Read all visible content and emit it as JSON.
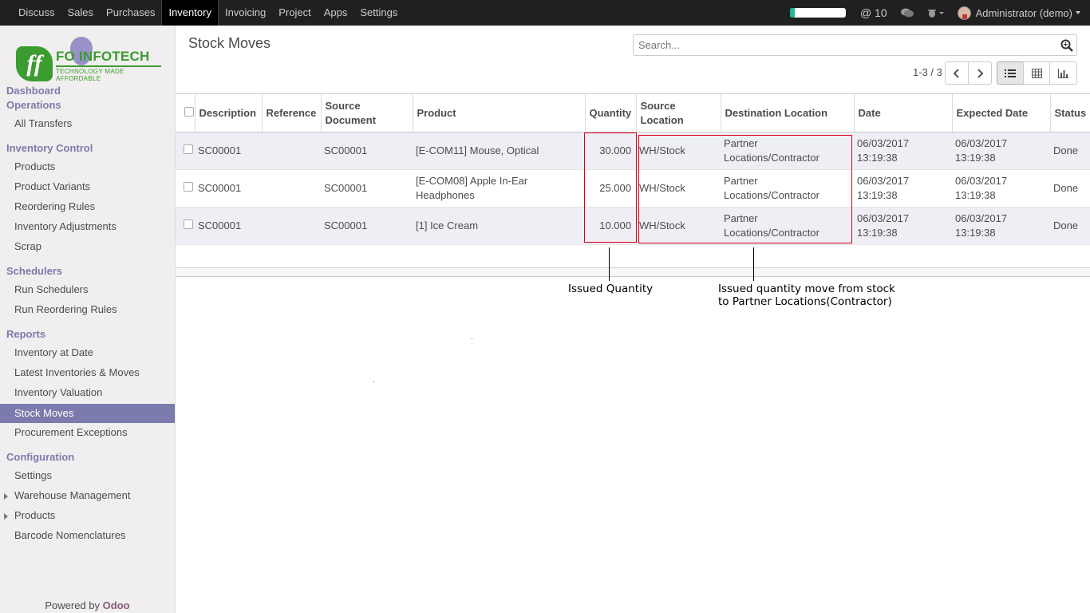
{
  "topbar": {
    "menu": [
      "Discuss",
      "Sales",
      "Purchases",
      "Inventory",
      "Invoicing",
      "Project",
      "Apps",
      "Settings"
    ],
    "active_menu": "Inventory",
    "progress_fraction": 0.08,
    "mentions": "@ 10",
    "icons": [
      "chat-icon",
      "bug-icon"
    ],
    "user": "Administrator (demo)"
  },
  "logo": {
    "name": "FO  INFOTECH",
    "tagline": "TECHNOLOGY MADE AFFORDABLE"
  },
  "sidebar": {
    "sections": [
      {
        "title": "Dashboard",
        "items": []
      },
      {
        "title": "Operations",
        "items": [
          "All Transfers"
        ]
      },
      {
        "title": "Inventory Control",
        "items": [
          "Products",
          "Product Variants",
          "Reordering Rules",
          "Inventory Adjustments",
          "Scrap"
        ]
      },
      {
        "title": "Schedulers",
        "items": [
          "Run Schedulers",
          "Run Reordering Rules"
        ]
      },
      {
        "title": "Reports",
        "items": [
          "Inventory at Date",
          "Latest Inventories & Moves",
          "Inventory Valuation",
          "Stock Moves",
          "Procurement Exceptions"
        ]
      },
      {
        "title": "Configuration",
        "items": [
          "Settings",
          "Warehouse Management",
          "Products",
          "Barcode Nomenclatures"
        ]
      }
    ],
    "active_item": "Stock Moves",
    "powered_by": "Powered by",
    "powered_brand": "Odoo"
  },
  "main": {
    "title": "Stock Moves",
    "search_placeholder": "Search...",
    "pager": "1-3 / 3"
  },
  "table": {
    "headers": [
      "Description",
      "Reference",
      "Source Document",
      "Product",
      "Quantity",
      "Source Location",
      "Destination Location",
      "Date",
      "Expected Date",
      "Status"
    ],
    "rows": [
      {
        "description": "SC00001",
        "reference": "",
        "source_document": "SC00001",
        "product": "[E-COM11] Mouse, Optical",
        "quantity": "30.000",
        "source_location": "WH/Stock",
        "destination": "Partner Locations/Contractor",
        "date": "06/03/2017 13:19:38",
        "expected_date": "06/03/2017 13:19:38",
        "status": "Done"
      },
      {
        "description": "SC00001",
        "reference": "",
        "source_document": "SC00001",
        "product": "[E-COM08] Apple In-Ear Headphones",
        "quantity": "25.000",
        "source_location": "WH/Stock",
        "destination": "Partner Locations/Contractor",
        "date": "06/03/2017 13:19:38",
        "expected_date": "06/03/2017 13:19:38",
        "status": "Done"
      },
      {
        "description": "SC00001",
        "reference": "",
        "source_document": "SC00001",
        "product": "[1] Ice Cream",
        "quantity": "10.000",
        "source_location": "WH/Stock",
        "destination": "Partner Locations/Contractor",
        "date": "06/03/2017 13:19:38",
        "expected_date": "06/03/2017 13:19:38",
        "status": "Done"
      }
    ]
  },
  "annotations": {
    "quantity_note": "Issued Quantity",
    "location_note_line1": "Issued quantity move from stock",
    "location_note_line2": "to Partner Locations(Contractor)"
  }
}
